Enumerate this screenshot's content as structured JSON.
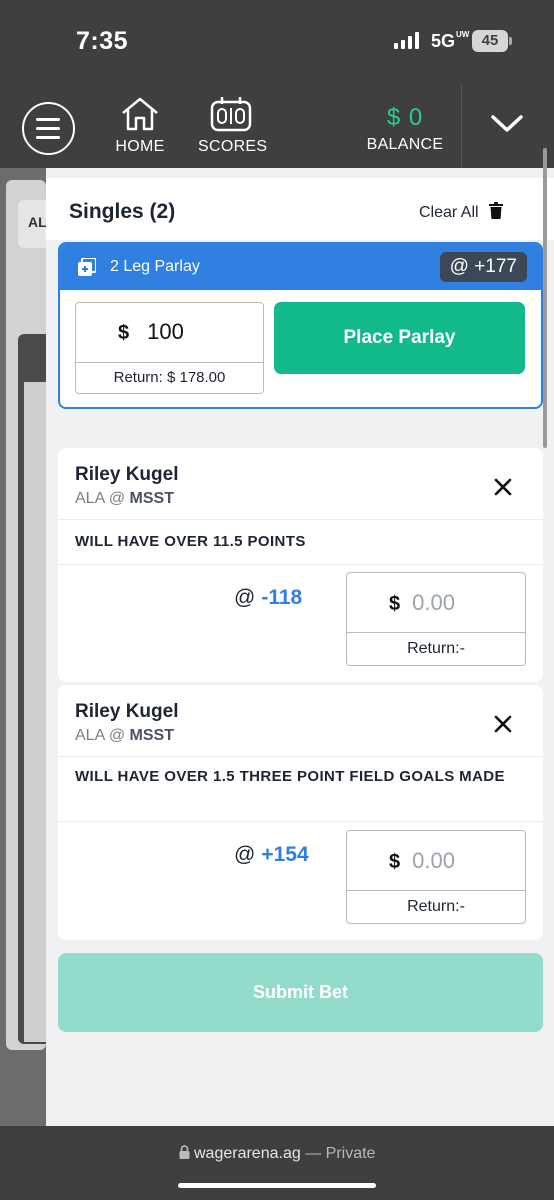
{
  "status": {
    "time": "7:35",
    "network": "5G",
    "network_sub": "UW",
    "battery": "45"
  },
  "nav": {
    "home_label": "HOME",
    "scores_label": "SCORES",
    "balance_amount": "$ 0",
    "balance_label": "BALANCE"
  },
  "background": {
    "card_text": "AL"
  },
  "slip": {
    "title": "Singles (2)",
    "clear_all": "Clear All",
    "parlay": {
      "title": "2 Leg Parlay",
      "odds": "@ +177",
      "currency": "$",
      "stake": "100",
      "return": "Return: $ 178.00",
      "place_label": "Place Parlay"
    },
    "bets": [
      {
        "player": "Riley Kugel",
        "away": "ALA",
        "at": "@",
        "home": "MSST",
        "market": "WILL HAVE OVER 11.5 POINTS",
        "at_symbol": "@",
        "odds": "-118",
        "currency": "$",
        "stake_placeholder": "0.00",
        "return": "Return:-"
      },
      {
        "player": "Riley Kugel",
        "away": "ALA",
        "at": "@",
        "home": "MSST",
        "market": "WILL HAVE OVER 1.5 THREE POINT FIELD GOALS MADE",
        "at_symbol": "@",
        "odds": "+154",
        "currency": "$",
        "stake_placeholder": "0.00",
        "return": "Return:-"
      }
    ],
    "submit_label": "Submit Bet"
  },
  "browser": {
    "url": "wagerarena.ag",
    "privacy": "— Private"
  },
  "colors": {
    "accent_blue": "#2f80e0",
    "accent_green": "#12b98a",
    "balance_green": "#1fd38a",
    "submit_disabled": "#93dccb"
  }
}
